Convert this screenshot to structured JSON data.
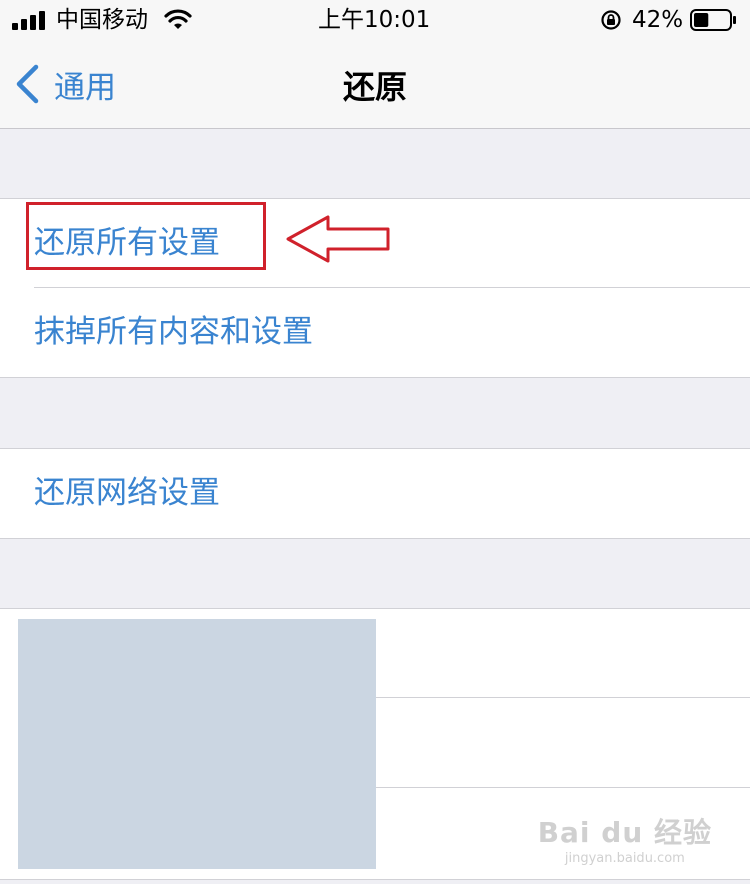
{
  "status_bar": {
    "carrier": "中国移动",
    "time": "上午10:01",
    "battery_percent": "42%",
    "battery_level": 0.42,
    "icons": [
      "signal-icon",
      "wifi-icon",
      "orientation-lock-icon",
      "battery-icon"
    ]
  },
  "nav": {
    "back_label": "通用",
    "title": "还原"
  },
  "groups": {
    "g1": [
      "还原所有设置",
      "抹掉所有内容和设置"
    ],
    "g2": [
      "还原网络设置"
    ]
  },
  "colors": {
    "link": "#3a84d0",
    "highlight": "#d0212b",
    "placeholder": "#cbd6e2"
  },
  "watermark": {
    "text": "Bai du 经验",
    "sub": "jingyan.baidu.com"
  }
}
